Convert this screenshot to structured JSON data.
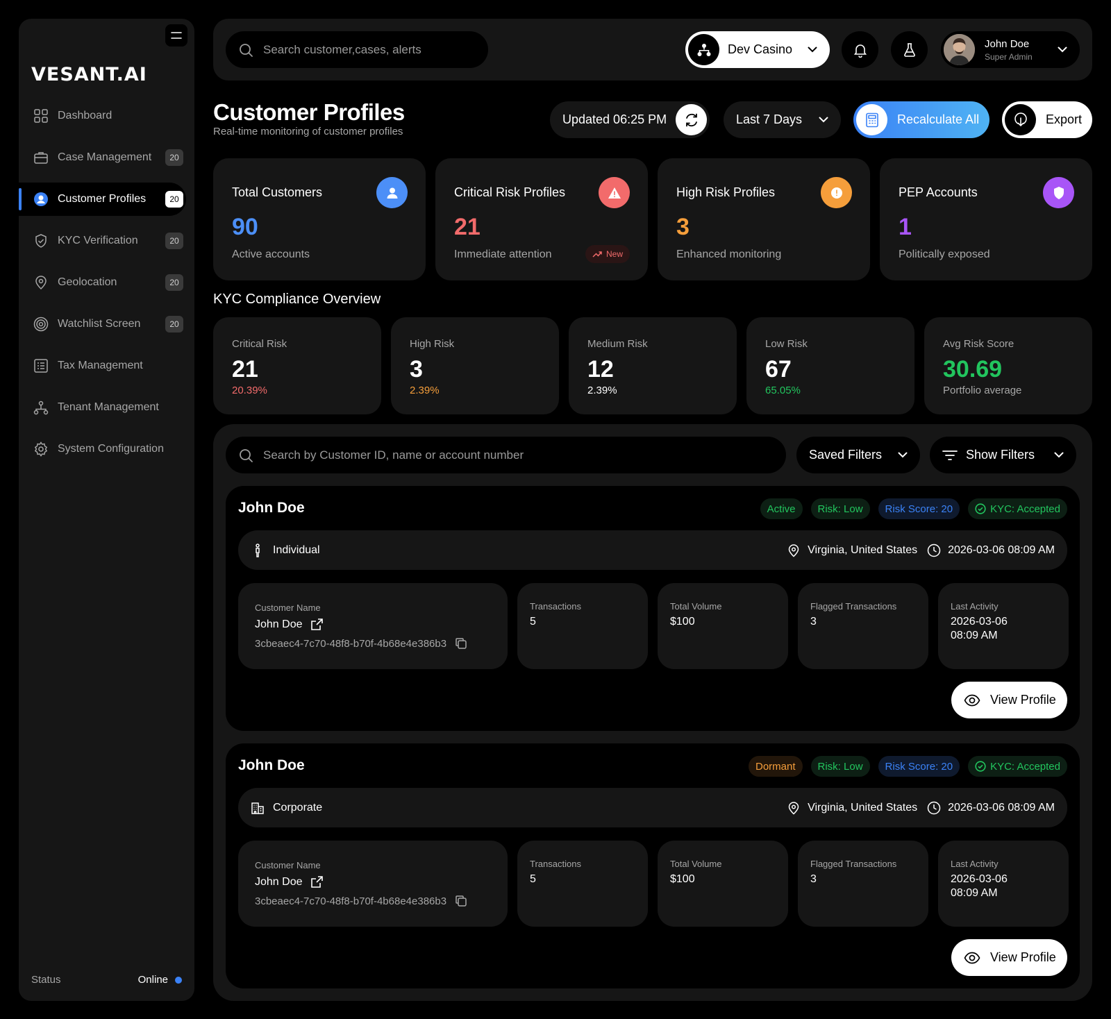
{
  "app": {
    "logo": "VESANT.AI"
  },
  "sidebar": {
    "items": [
      {
        "label": "Dashboard",
        "icon": "grid-icon",
        "badge": ""
      },
      {
        "label": "Case Management",
        "icon": "briefcase-icon",
        "badge": "20"
      },
      {
        "label": "Customer Profiles",
        "icon": "user-circle-icon",
        "badge": "20",
        "active": true
      },
      {
        "label": "KYC Verification",
        "icon": "shield-check-icon",
        "badge": "20"
      },
      {
        "label": "Geolocation",
        "icon": "map-pin-icon",
        "badge": "20"
      },
      {
        "label": "Watchlist Screen",
        "icon": "target-icon",
        "badge": "20"
      },
      {
        "label": "Tax Management",
        "icon": "receipt-icon",
        "badge": ""
      },
      {
        "label": "Tenant Management",
        "icon": "hierarchy-icon",
        "badge": ""
      },
      {
        "label": "System Configuration",
        "icon": "gear-icon",
        "badge": ""
      }
    ],
    "status_label": "Status",
    "status_value": "Online"
  },
  "topbar": {
    "search_placeholder": "Search customer,cases, alerts",
    "tenant": "Dev Casino",
    "user_name": "John Doe",
    "user_role": "Super Admin"
  },
  "header": {
    "title": "Customer Profiles",
    "subtitle": "Real-time monitoring of customer profiles",
    "updated": "Updated 06:25 PM",
    "range": "Last 7 Days",
    "recalc": "Recalculate All",
    "export": "Export"
  },
  "stats": [
    {
      "title": "Total Customers",
      "value": "90",
      "sub": "Active accounts",
      "color": "#4c8ff7",
      "icon": "user-icon"
    },
    {
      "title": "Critical Risk Profiles",
      "value": "21",
      "sub": "Immediate attention",
      "color": "#f26b6b",
      "icon": "warning-icon",
      "chip": "New"
    },
    {
      "title": "High Risk Profiles",
      "value": "3",
      "sub": "Enhanced monitoring",
      "color": "#f59e3b",
      "icon": "alert-circle-icon"
    },
    {
      "title": "PEP Accounts",
      "value": "1",
      "sub": "Politically exposed",
      "color": "#a855f7",
      "icon": "shield-icon"
    }
  ],
  "kyc": {
    "title": "KYC Compliance Overview",
    "items": [
      {
        "label": "Critical Risk",
        "value": "21",
        "pct": "20.39%",
        "color": "#f26b6b"
      },
      {
        "label": "High Risk",
        "value": "3",
        "pct": "2.39%",
        "color": "#f59e3b"
      },
      {
        "label": "Medium Risk",
        "value": "12",
        "pct": "2.39%",
        "color": "#ffffff"
      },
      {
        "label": "Low Risk",
        "value": "67",
        "pct": "65.05%",
        "color": "#22c55e"
      },
      {
        "label": "Avg Risk Score",
        "value": "30.69",
        "pct": "Portfolio average",
        "color": "#a7a7a7"
      }
    ]
  },
  "list": {
    "search_placeholder": "Search by Customer ID, name or account number",
    "saved_filters": "Saved Filters",
    "show_filters": "Show Filters",
    "customers": [
      {
        "name": "John Doe",
        "status": "Active",
        "risk": "Risk: Low",
        "score": "Risk Score: 20",
        "kyc": "KYC: Accepted",
        "type": "Individual",
        "location": "Virginia, United States",
        "datetime": "2026-03-06 08:09 AM",
        "cn_label": "Customer Name",
        "cn_name": "John Doe",
        "cn_id": "3cbeaec4-7c70-48f8-b70f-4b68e4e386b3",
        "tx_label": "Transactions",
        "tx": "5",
        "vol_label": "Total Volume",
        "vol": "$100",
        "flag_label": "Flagged Transactions",
        "flag": "3",
        "last_label": "Last Activity",
        "last1": "2026-03-06",
        "last2": "08:09 AM",
        "view": "View Profile"
      },
      {
        "name": "John Doe",
        "status": "Dormant",
        "risk": "Risk: Low",
        "score": "Risk Score: 20",
        "kyc": "KYC: Accepted",
        "type": "Corporate",
        "location": "Virginia, United States",
        "datetime": "2026-03-06 08:09 AM",
        "cn_label": "Customer Name",
        "cn_name": "John Doe",
        "cn_id": "3cbeaec4-7c70-48f8-b70f-4b68e4e386b3",
        "tx_label": "Transactions",
        "tx": "5",
        "vol_label": "Total Volume",
        "vol": "$100",
        "flag_label": "Flagged Transactions",
        "flag": "3",
        "last_label": "Last Activity",
        "last1": "2026-03-06",
        "last2": "08:09 AM",
        "view": "View Profile"
      }
    ]
  }
}
